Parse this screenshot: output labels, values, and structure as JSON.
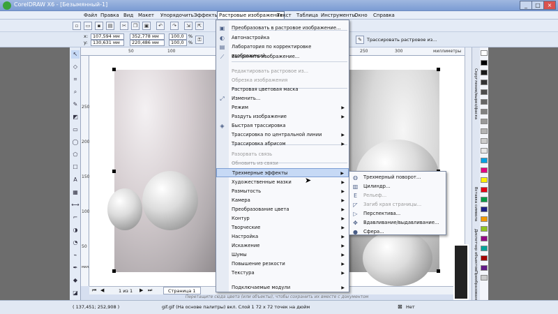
{
  "window": {
    "title": "CorelDRAW X6 - [Безымянный-1]",
    "controls": [
      "_",
      "□",
      "×"
    ]
  },
  "menubar": {
    "items": [
      "Файл",
      "Правка",
      "Вид",
      "Макет",
      "Упорядочить",
      "Эффекты",
      "Растровые изображения",
      "Текст",
      "Таблица",
      "Инструменты",
      "Окно",
      "Справка"
    ]
  },
  "toolbar": {
    "x_label": "x:",
    "y_label": "y:",
    "x_value": "107,594 мм",
    "y_value": "130,631 мм",
    "w_value": "352,778 мм",
    "h_value": "220,486 мм",
    "scale_x": "100,0",
    "scale_y": "100,0",
    "percent": "%",
    "trace_button": "Трассировать растровое из..."
  },
  "ruler": {
    "h_ticks": [
      "50",
      "100",
      "250",
      "300"
    ],
    "h_unit": "миллиметры",
    "v_ticks": [
      "250",
      "200",
      "150",
      "100",
      "50"
    ],
    "v_unit": "миллиметры"
  },
  "dropdown": {
    "items": [
      {
        "label": "Преобразовать в растровое изображение...",
        "disabled": false,
        "arrow": false,
        "icon": "convert-icon",
        "glyph": "▣"
      },
      {
        "label": "Автонастройка",
        "disabled": false,
        "arrow": false,
        "icon": "auto-adjust-icon",
        "glyph": "◐"
      },
      {
        "label": "Лаборатория по корректировке изображений...",
        "disabled": false,
        "arrow": false,
        "icon": "lab-icon",
        "glyph": "▤"
      },
      {
        "label": "Выпрямить изображение...",
        "disabled": false,
        "arrow": false,
        "icon": "straighten-icon",
        "glyph": "⟋"
      },
      {
        "label": "Редактировать растровое из...",
        "disabled": true,
        "arrow": false,
        "icon": "",
        "glyph": ""
      },
      {
        "label": "Обрезка изображения",
        "disabled": true,
        "arrow": false,
        "icon": "",
        "glyph": ""
      },
      {
        "label": "Растровая цветовая маска",
        "disabled": false,
        "arrow": false,
        "icon": "",
        "glyph": ""
      },
      {
        "label": "Изменить...",
        "disabled": false,
        "arrow": false,
        "icon": "resample-icon",
        "glyph": "⤢"
      },
      {
        "label": "Режим",
        "disabled": false,
        "arrow": true,
        "icon": "",
        "glyph": ""
      },
      {
        "label": "Раздуть изображение",
        "disabled": false,
        "arrow": true,
        "icon": "",
        "glyph": ""
      },
      {
        "label": "Быстрая трассировка",
        "disabled": false,
        "arrow": false,
        "icon": "quick-trace-icon",
        "glyph": "◈"
      },
      {
        "label": "Трассировка по центральной линии",
        "disabled": false,
        "arrow": true,
        "icon": "",
        "glyph": ""
      },
      {
        "label": "Трассировка абрисом",
        "disabled": false,
        "arrow": true,
        "icon": "",
        "glyph": ""
      },
      {
        "label": "Разорвать связь",
        "disabled": true,
        "arrow": false,
        "icon": "",
        "glyph": ""
      },
      {
        "label": "Обновить из связи",
        "disabled": true,
        "arrow": false,
        "icon": "",
        "glyph": ""
      },
      {
        "label": "Трехмерные эффекты",
        "disabled": false,
        "arrow": true,
        "icon": "",
        "glyph": ""
      },
      {
        "label": "Художественные мазки",
        "disabled": false,
        "arrow": true,
        "icon": "",
        "glyph": ""
      },
      {
        "label": "Размытость",
        "disabled": false,
        "arrow": true,
        "icon": "",
        "glyph": ""
      },
      {
        "label": "Камера",
        "disabled": false,
        "arrow": true,
        "icon": "",
        "glyph": ""
      },
      {
        "label": "Преобразование цвета",
        "disabled": false,
        "arrow": true,
        "icon": "",
        "glyph": ""
      },
      {
        "label": "Контур",
        "disabled": false,
        "arrow": true,
        "icon": "",
        "glyph": ""
      },
      {
        "label": "Творческие",
        "disabled": false,
        "arrow": true,
        "icon": "",
        "glyph": ""
      },
      {
        "label": "Настройка",
        "disabled": false,
        "arrow": true,
        "icon": "",
        "glyph": ""
      },
      {
        "label": "Искажение",
        "disabled": false,
        "arrow": true,
        "icon": "",
        "glyph": ""
      },
      {
        "label": "Шумы",
        "disabled": false,
        "arrow": true,
        "icon": "",
        "glyph": ""
      },
      {
        "label": "Повышение резкости",
        "disabled": false,
        "arrow": true,
        "icon": "",
        "glyph": ""
      },
      {
        "label": "Текстура",
        "disabled": false,
        "arrow": true,
        "icon": "",
        "glyph": ""
      },
      {
        "label": "Подключаемые модули",
        "disabled": false,
        "arrow": true,
        "icon": "",
        "glyph": ""
      }
    ]
  },
  "submenu": {
    "items": [
      {
        "label": "Трехмерный поворот...",
        "disabled": false,
        "icon": "rotate3d-icon",
        "glyph": "◍"
      },
      {
        "label": "Цилиндр...",
        "disabled": false,
        "icon": "cylinder-icon",
        "glyph": "▥"
      },
      {
        "label": "Рельеф...",
        "disabled": true,
        "icon": "emboss-icon",
        "glyph": "E"
      },
      {
        "label": "Загиб края страницы...",
        "disabled": true,
        "icon": "page-curl-icon",
        "glyph": "◸"
      },
      {
        "label": "Перспектива...",
        "disabled": false,
        "icon": "perspective-icon",
        "glyph": "▷"
      },
      {
        "label": "Вдавливание/выдавливание...",
        "disabled": false,
        "icon": "pinch-icon",
        "glyph": "✥"
      },
      {
        "label": "Сфера...",
        "disabled": false,
        "icon": "sphere-icon",
        "glyph": "●"
      }
    ]
  },
  "pages": {
    "counter": "1 из 1",
    "tab": "Страница 1"
  },
  "status": {
    "hint": "Перетащите сюда цвета (или объекты), чтобы сохранить их вместе с документом",
    "coords": "( 137,451; 252,908 )",
    "info": "gif.gif (На основе палитры) вкл. Слой 1 72 х 72 точек на дюйм",
    "fill_none": "Нет"
  },
  "docker_tabs": [
    "Скругление/вырез/фаска",
    "Вставка символа",
    "Диспетчер объектов",
    "Преобразования"
  ],
  "palette": [
    "#ffffff",
    "#000000",
    "#1a1a1a",
    "#333333",
    "#4d4d4d",
    "#666666",
    "#808080",
    "#999999",
    "#b3b3b3",
    "#cccccc",
    "#e6e6e6",
    "#00a0e3",
    "#e4007f",
    "#fff100",
    "#e60012",
    "#009944",
    "#1d2088",
    "#f39800",
    "#8fc31f",
    "#920783",
    "#00a29a",
    "#a40000",
    "#601986",
    "#c9caca"
  ]
}
